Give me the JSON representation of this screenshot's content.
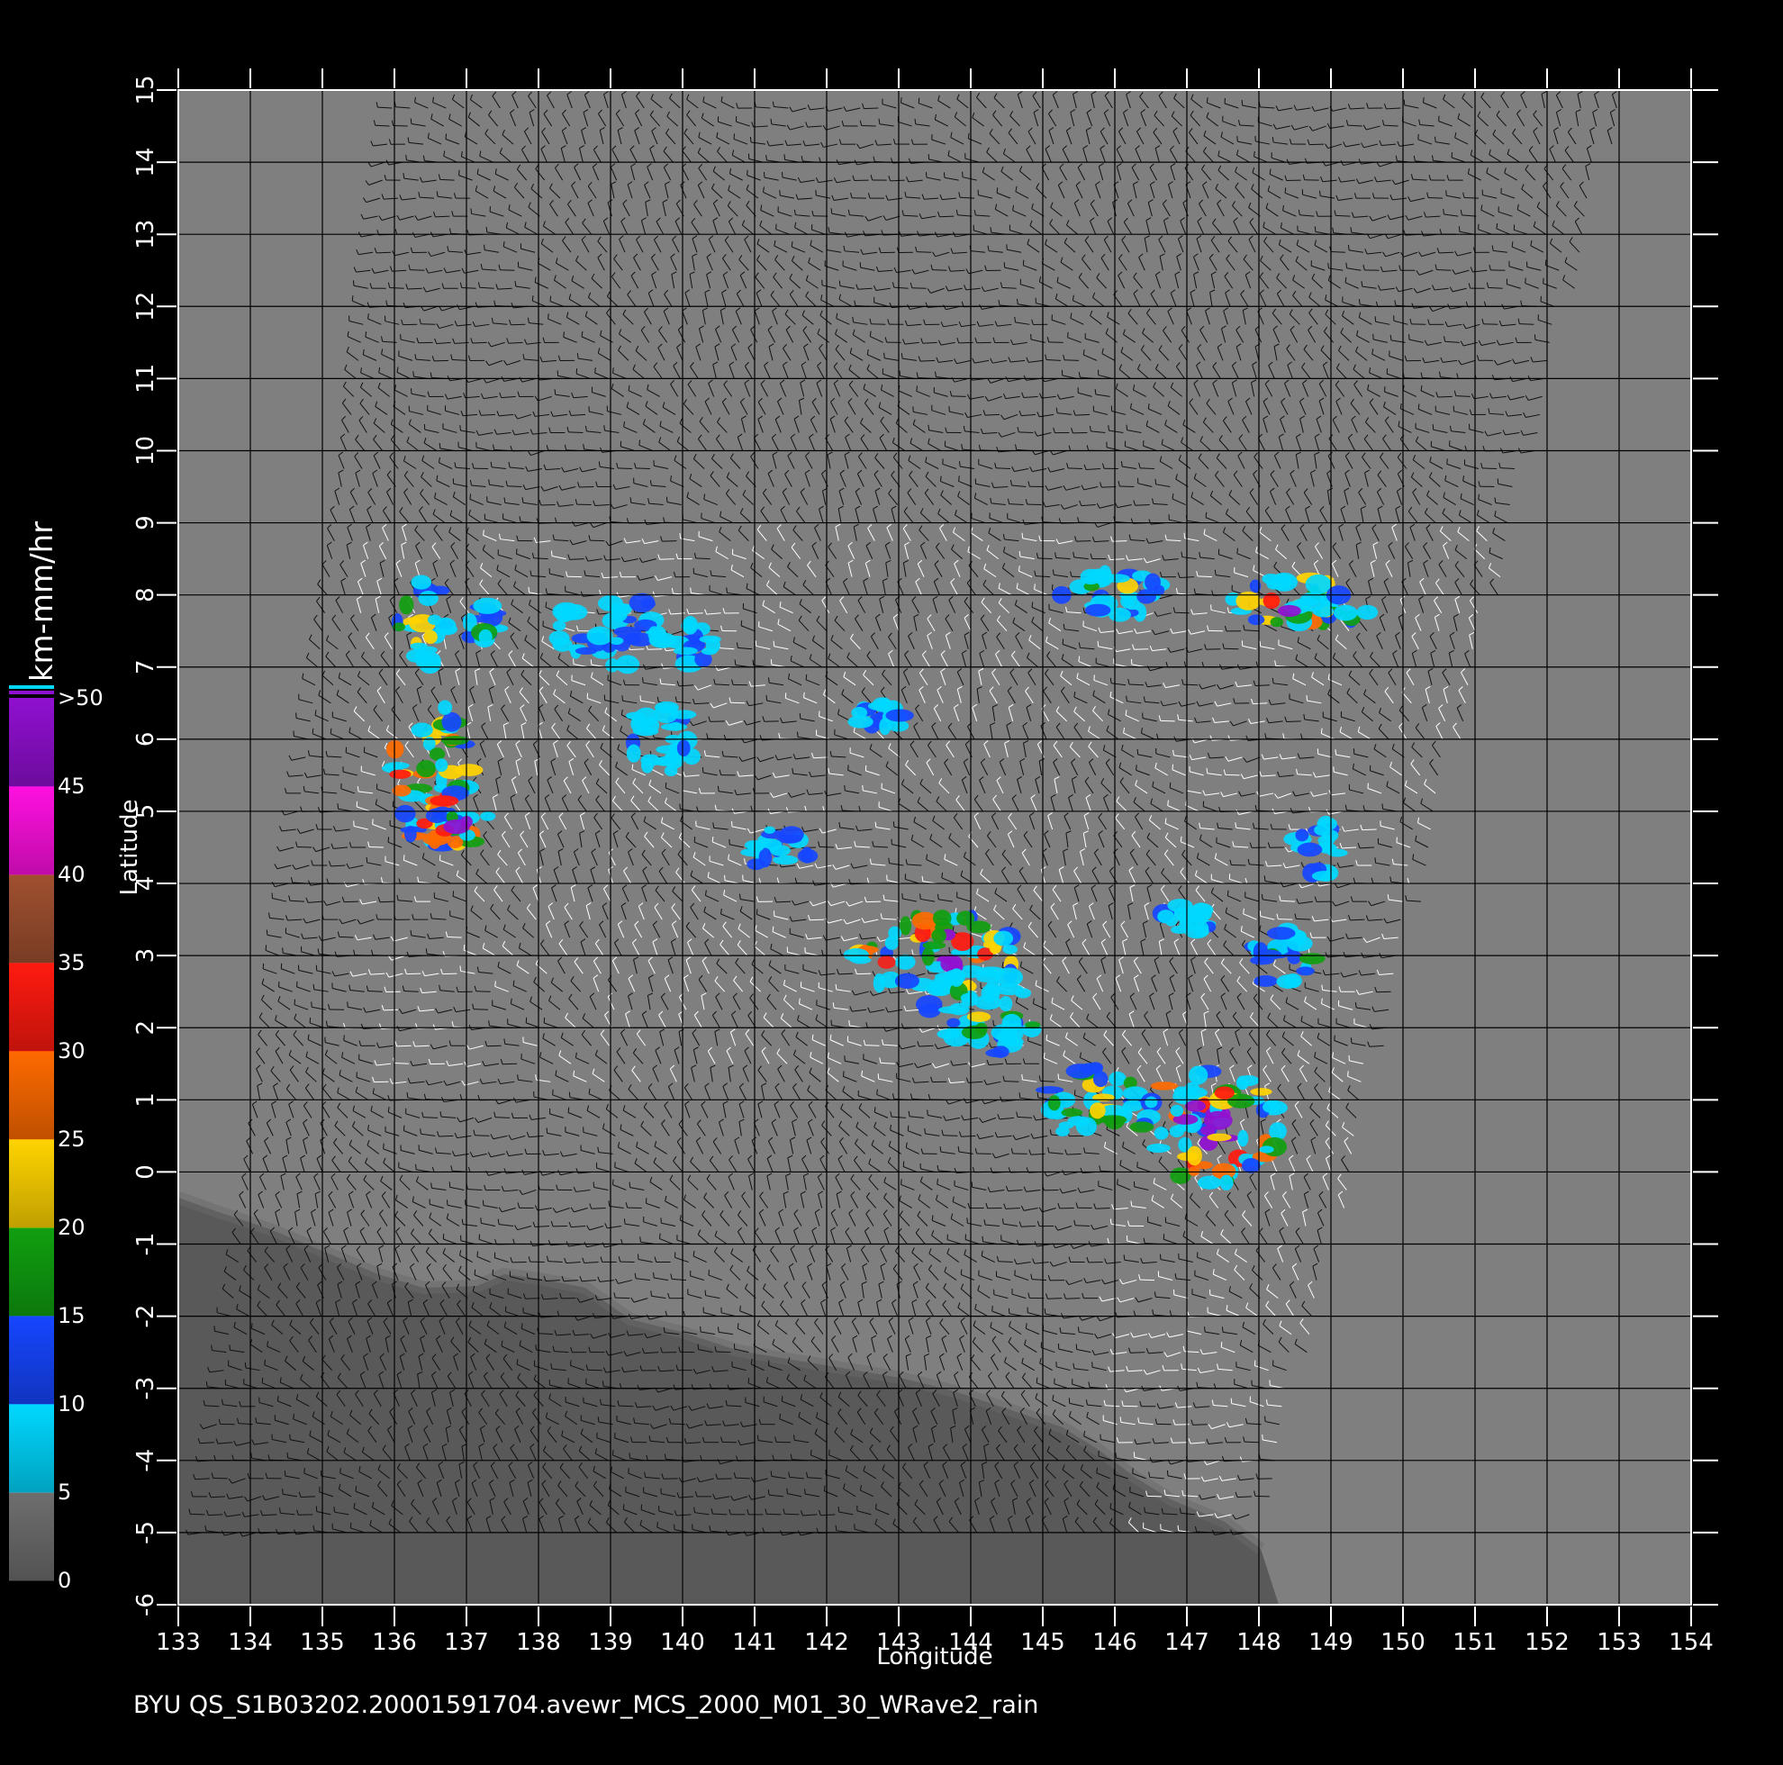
{
  "chart_data": {
    "type": "heatmap",
    "xlabel": "Longitude",
    "ylabel": "Latitude",
    "xlim": [
      133,
      154
    ],
    "ylim": [
      -6,
      15
    ],
    "x_ticks": [
      "133",
      "134",
      "135",
      "136",
      "137",
      "138",
      "139",
      "140",
      "141",
      "142",
      "143",
      "144",
      "145",
      "146",
      "147",
      "148",
      "149",
      "150",
      "151",
      "152",
      "153",
      "154"
    ],
    "y_ticks": [
      "-6",
      "-5",
      "-4",
      "-3",
      "-2",
      "-1",
      "0",
      "1",
      "2",
      "3",
      "4",
      "5",
      "6",
      "7",
      "8",
      "9",
      "10",
      "11",
      "12",
      "13",
      "14",
      "15"
    ],
    "grid": true,
    "colorbar": {
      "title": "km-mm/hr",
      "labels": [
        "0",
        "5",
        "10",
        "15",
        "20",
        "25",
        "30",
        "35",
        "40",
        "45",
        ">50"
      ],
      "bands": [
        {
          "from": 0,
          "to": 5,
          "color": "#6e6e6e"
        },
        {
          "from": 5,
          "to": 10,
          "color": "#00d8ff"
        },
        {
          "from": 10,
          "to": 15,
          "color": "#1646ff"
        },
        {
          "from": 15,
          "to": 20,
          "color": "#10a010"
        },
        {
          "from": 20,
          "to": 25,
          "color": "#ffd400"
        },
        {
          "from": 25,
          "to": 30,
          "color": "#ff6a00"
        },
        {
          "from": 30,
          "to": 35,
          "color": "#ff1a10"
        },
        {
          "from": 35,
          "to": 40,
          "color": "#a05030"
        },
        {
          "from": 40,
          "to": 45,
          "color": "#ff10e0"
        },
        {
          "from": 45,
          "to": 50,
          "color": "#9010d0"
        }
      ]
    },
    "background_color": "#7f7f7f",
    "land_color": "#595959",
    "rain_cells": [
      {
        "lon": 136.5,
        "lat": 5.5,
        "rx": 0.55,
        "ry": 1.1,
        "level": "high"
      },
      {
        "lon": 136.4,
        "lat": 7.6,
        "rx": 0.4,
        "ry": 0.6,
        "level": "mid"
      },
      {
        "lon": 136.9,
        "lat": 4.8,
        "rx": 0.45,
        "ry": 0.3,
        "level": "high"
      },
      {
        "lon": 137.2,
        "lat": 7.6,
        "rx": 0.2,
        "ry": 0.3,
        "level": "mid"
      },
      {
        "lon": 139.7,
        "lat": 6.0,
        "rx": 0.5,
        "ry": 0.5,
        "level": "low"
      },
      {
        "lon": 141.3,
        "lat": 4.5,
        "rx": 0.5,
        "ry": 0.3,
        "level": "mid"
      },
      {
        "lon": 143.6,
        "lat": 3.0,
        "rx": 1.2,
        "ry": 0.6,
        "level": "high"
      },
      {
        "lon": 144.2,
        "lat": 2.2,
        "rx": 0.8,
        "ry": 0.6,
        "level": "mid"
      },
      {
        "lon": 145.6,
        "lat": 1.0,
        "rx": 0.7,
        "ry": 0.5,
        "level": "mid"
      },
      {
        "lon": 147.3,
        "lat": 0.6,
        "rx": 1.0,
        "ry": 0.8,
        "level": "high"
      },
      {
        "lon": 148.3,
        "lat": 3.0,
        "rx": 0.5,
        "ry": 0.4,
        "level": "mid"
      },
      {
        "lon": 148.8,
        "lat": 4.5,
        "rx": 0.3,
        "ry": 0.5,
        "level": "low"
      },
      {
        "lon": 146.0,
        "lat": 8.0,
        "rx": 0.8,
        "ry": 0.3,
        "level": "mid"
      },
      {
        "lon": 148.5,
        "lat": 7.9,
        "rx": 1.1,
        "ry": 0.35,
        "level": "high"
      },
      {
        "lon": 139.0,
        "lat": 7.5,
        "rx": 0.8,
        "ry": 0.5,
        "level": "low"
      },
      {
        "lon": 140.2,
        "lat": 7.3,
        "rx": 0.3,
        "ry": 0.3,
        "level": "low"
      },
      {
        "lon": 142.8,
        "lat": 6.3,
        "rx": 0.4,
        "ry": 0.2,
        "level": "low"
      },
      {
        "lon": 147.0,
        "lat": 3.5,
        "rx": 0.4,
        "ry": 0.2,
        "level": "low"
      }
    ]
  },
  "footer": {
    "caption": "BYU  QS_S1B03202.20001591704.avewr_MCS_2000_M01_30_WRave2_rain"
  }
}
